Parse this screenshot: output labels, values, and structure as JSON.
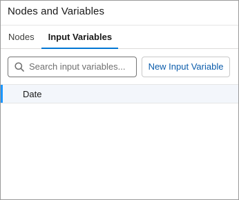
{
  "panel": {
    "title": "Nodes and Variables"
  },
  "tabs": [
    {
      "label": "Nodes",
      "active": false
    },
    {
      "label": "Input Variables",
      "active": true
    }
  ],
  "search": {
    "icon": "search-icon",
    "placeholder": "Search input variables...",
    "value": ""
  },
  "toolbar": {
    "new_button_label": "New Input Variable"
  },
  "variables": [
    {
      "label": "Date",
      "selected": true
    }
  ],
  "colors": {
    "accent": "#0176d3",
    "selected_bar": "#1b96ff",
    "button_text": "#0b5cab"
  }
}
